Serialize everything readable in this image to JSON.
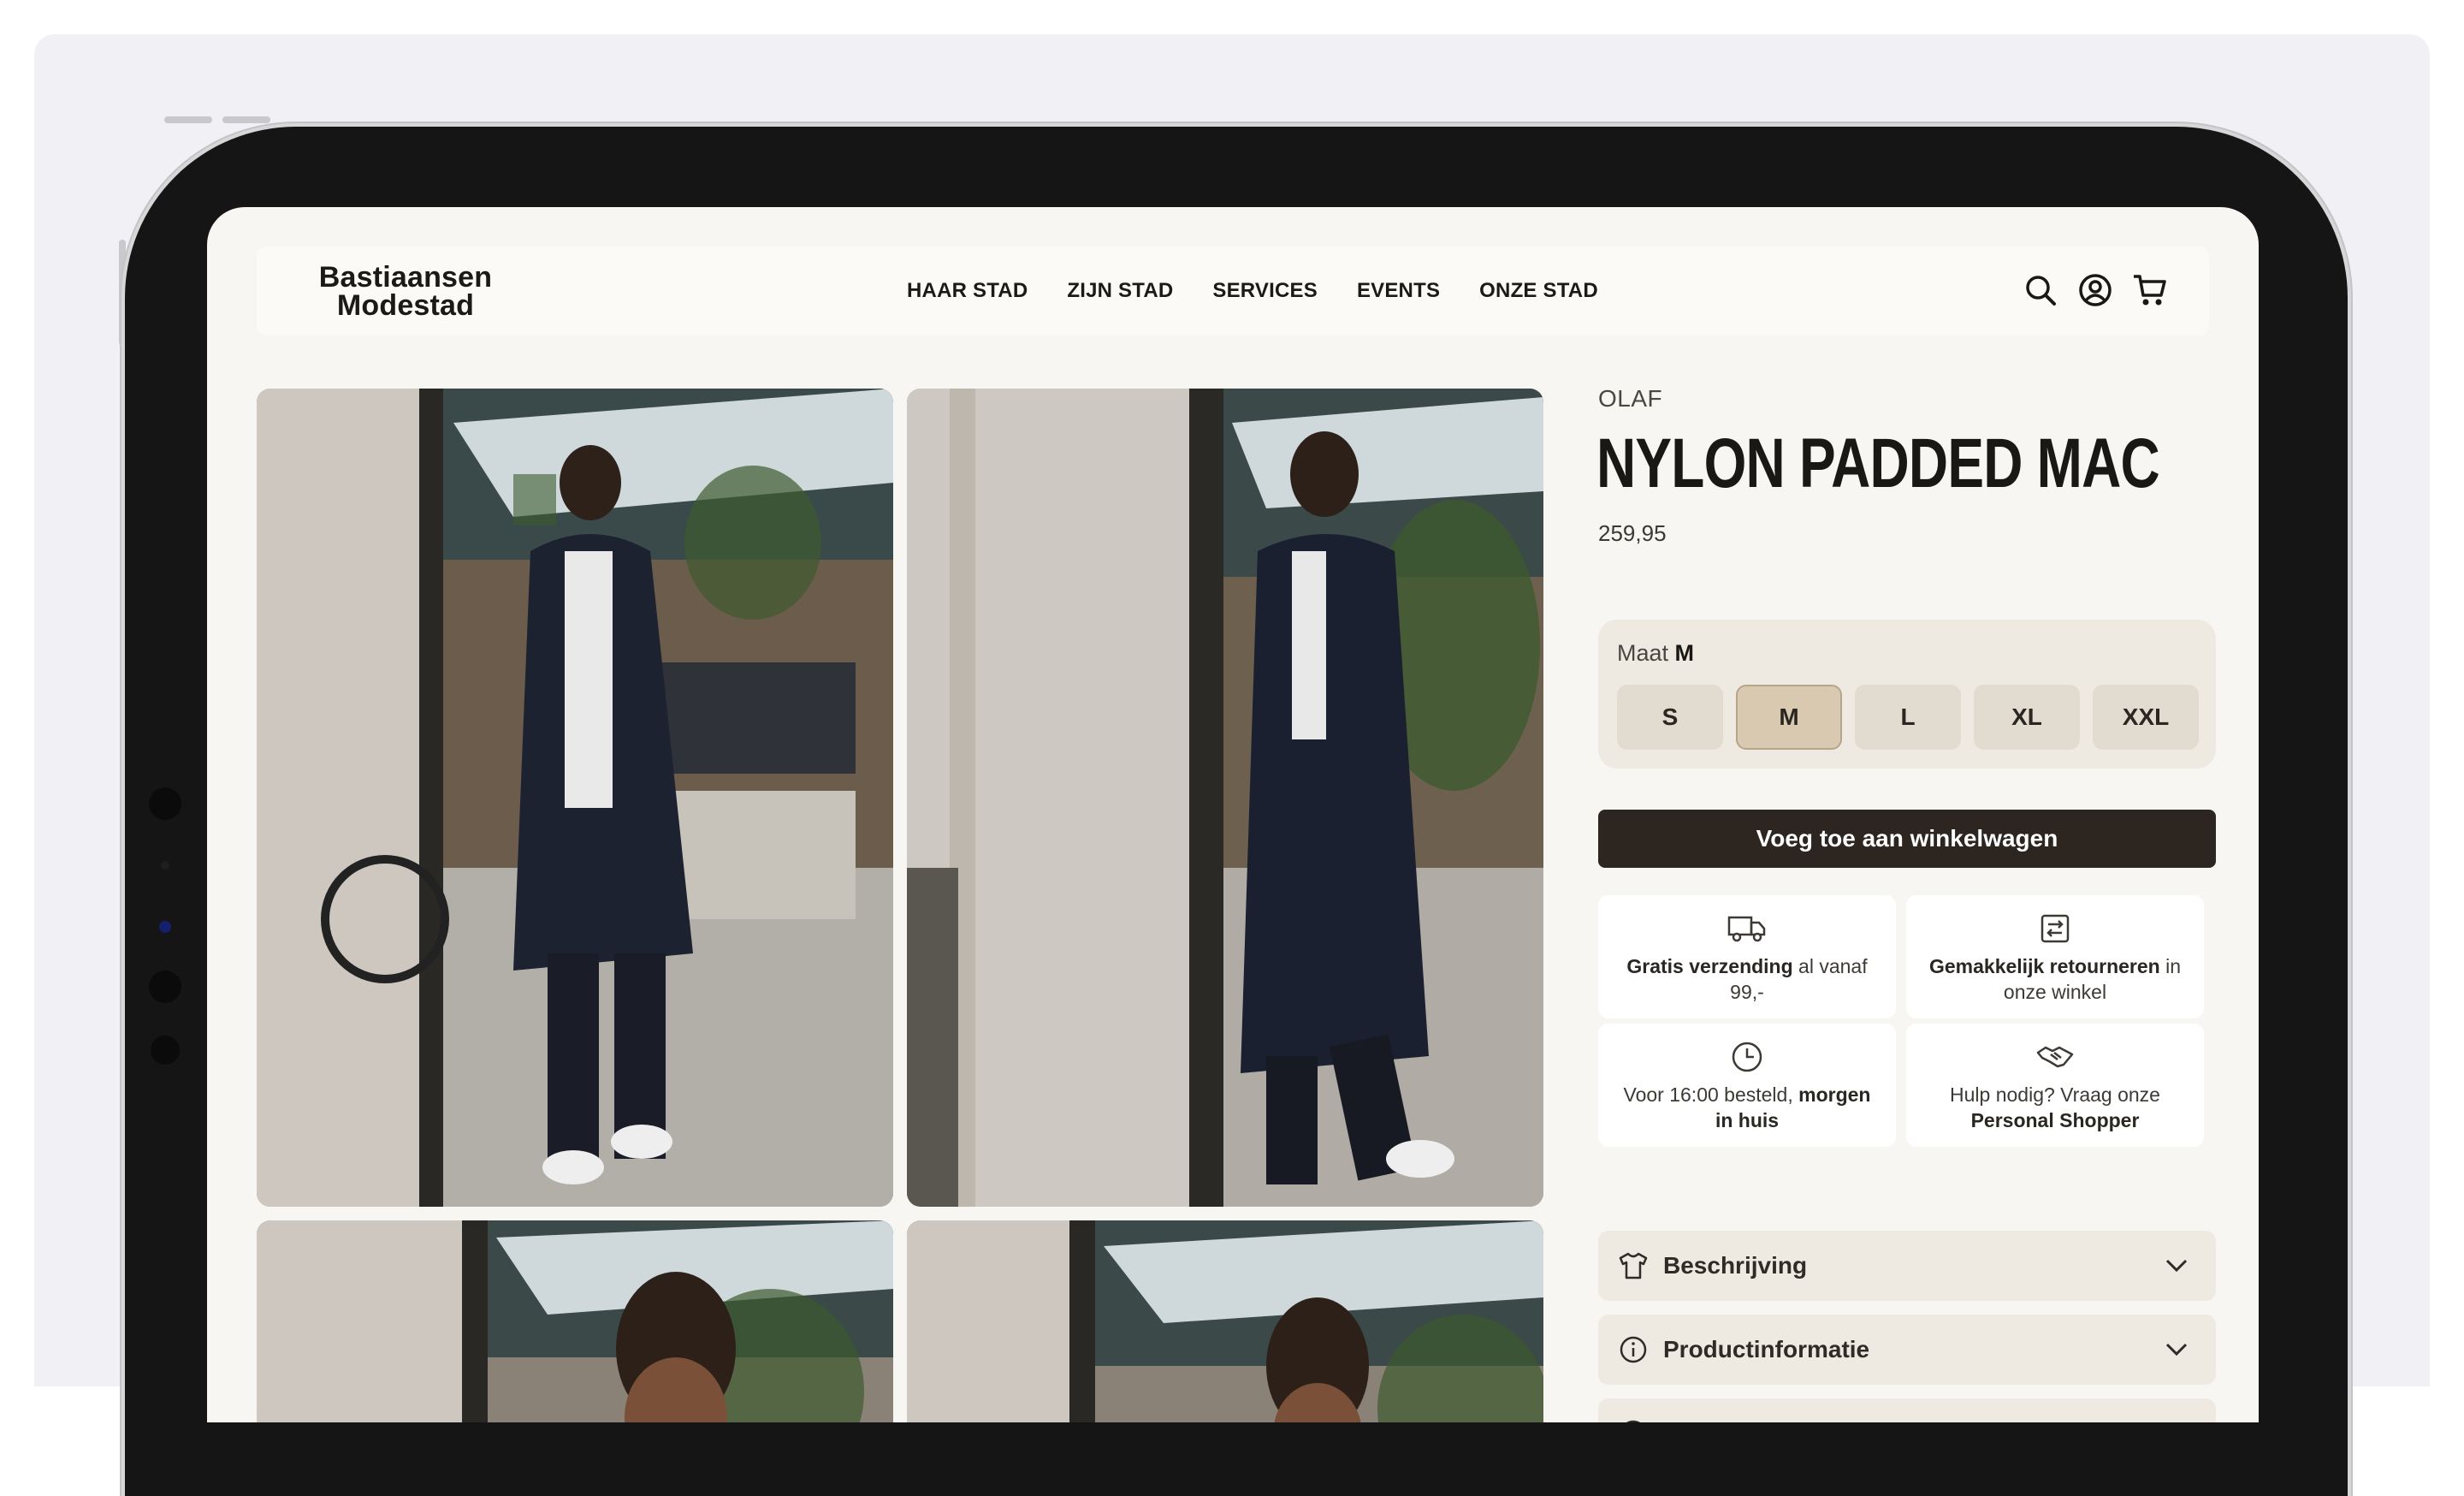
{
  "header": {
    "logo_line1": "Bastiaansen",
    "logo_line2": "Modestad",
    "nav": [
      "HAAR STAD",
      "ZIJN STAD",
      "SERVICES",
      "EVENTS",
      "ONZE STAD"
    ],
    "icons": [
      "search-icon",
      "account-icon",
      "cart-icon"
    ]
  },
  "product": {
    "brand": "OLAF",
    "title": "NYLON PADDED MAC",
    "price": "259,95",
    "size_label": "Maat",
    "selected_size": "M",
    "sizes": [
      "S",
      "M",
      "L",
      "XL",
      "XXL"
    ],
    "add_to_cart": "Voeg toe aan winkelwagen"
  },
  "features": [
    {
      "icon": "truck-icon",
      "bold": "Gratis verzending",
      "text": " al vanaf 99,-"
    },
    {
      "icon": "return-icon",
      "bold": "Gemakkelijk retourneren",
      "text": " in onze winkel"
    },
    {
      "icon": "clock-icon",
      "text": "Voor 16:00 besteld, ",
      "bold": "morgen in huis"
    },
    {
      "icon": "handshake-icon",
      "text": "Hulp nodig? Vraag onze ",
      "bold": "Personal Shopper"
    }
  ],
  "accordion": [
    {
      "icon": "shirt-icon",
      "label": "Beschrijving"
    },
    {
      "icon": "info-icon",
      "label": "Productinformatie"
    },
    {
      "icon": "brand-icon",
      "label": ""
    }
  ],
  "colors": {
    "background": "#f1f0f4",
    "page": "#f7f6f2",
    "panel": "#efeae1",
    "size_selected": "#d8c9b0",
    "button": "#2d2520"
  }
}
